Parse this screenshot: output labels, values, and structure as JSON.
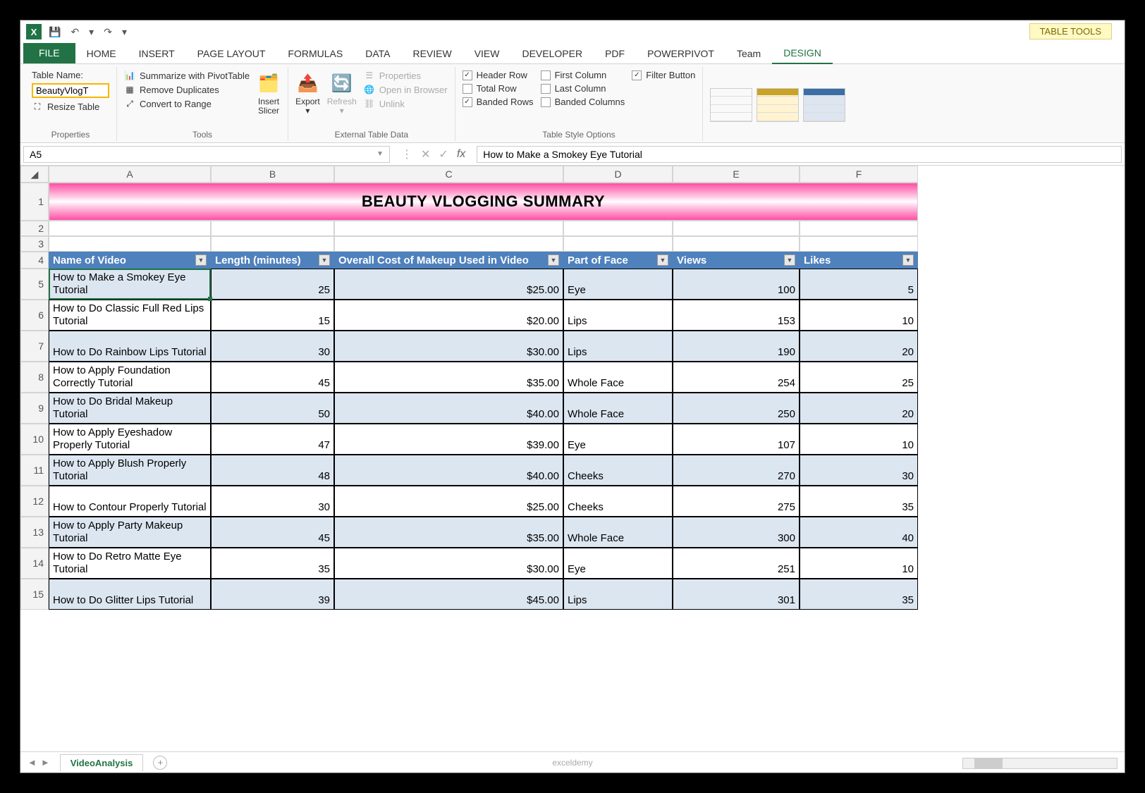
{
  "qat": {
    "save": "💾",
    "undo": "↶",
    "redo": "↷",
    "dd": "▾"
  },
  "table_tools_label": "TABLE TOOLS",
  "tabs": {
    "file": "FILE",
    "home": "HOME",
    "insert": "INSERT",
    "page_layout": "PAGE LAYOUT",
    "formulas": "FORMULAS",
    "data": "DATA",
    "review": "REVIEW",
    "view": "VIEW",
    "developer": "DEVELOPER",
    "pdf": "PDF",
    "powerpivot": "POWERPIVOT",
    "team": "Team",
    "design": "DESIGN"
  },
  "ribbon": {
    "properties": {
      "label": "Properties",
      "table_name_label": "Table Name:",
      "table_name_value": "BeautyVlogT",
      "resize": "Resize Table"
    },
    "tools": {
      "label": "Tools",
      "summarize": "Summarize with PivotTable",
      "remove_dup": "Remove Duplicates",
      "convert": "Convert to Range",
      "slicer": "Insert\nSlicer"
    },
    "external": {
      "label": "External Table Data",
      "export": "Export",
      "refresh": "Refresh",
      "props": "Properties",
      "open_browser": "Open in Browser",
      "unlink": "Unlink"
    },
    "style_opts": {
      "label": "Table Style Options",
      "header_row": "Header Row",
      "total_row": "Total Row",
      "banded_rows": "Banded Rows",
      "first_col": "First Column",
      "last_col": "Last Column",
      "banded_cols": "Banded Columns",
      "filter_btn": "Filter Button"
    }
  },
  "formula_bar": {
    "name_box": "A5",
    "value": "How to Make a Smokey Eye Tutorial"
  },
  "sheet": {
    "columns": [
      "A",
      "B",
      "C",
      "D",
      "E",
      "F"
    ],
    "title": "BEAUTY VLOGGING SUMMARY",
    "headers": [
      "Name of Video",
      "Length (minutes)",
      "Overall Cost of Makeup Used in Video",
      "Part of Face",
      "Views",
      "Likes"
    ],
    "rows": [
      {
        "n": 5,
        "a": "How to Make a Smokey Eye Tutorial",
        "b": "25",
        "c": "$25.00",
        "d": "Eye",
        "e": "100",
        "f": "5"
      },
      {
        "n": 6,
        "a": "How to Do Classic Full Red Lips Tutorial",
        "b": "15",
        "c": "$20.00",
        "d": "Lips",
        "e": "153",
        "f": "10"
      },
      {
        "n": 7,
        "a": "How to Do Rainbow Lips Tutorial",
        "b": "30",
        "c": "$30.00",
        "d": "Lips",
        "e": "190",
        "f": "20"
      },
      {
        "n": 8,
        "a": "How to Apply Foundation Correctly Tutorial",
        "b": "45",
        "c": "$35.00",
        "d": "Whole Face",
        "e": "254",
        "f": "25"
      },
      {
        "n": 9,
        "a": "How to Do Bridal Makeup Tutorial",
        "b": "50",
        "c": "$40.00",
        "d": "Whole Face",
        "e": "250",
        "f": "20"
      },
      {
        "n": 10,
        "a": "How to Apply Eyeshadow Properly Tutorial",
        "b": "47",
        "c": "$39.00",
        "d": "Eye",
        "e": "107",
        "f": "10"
      },
      {
        "n": 11,
        "a": "How to Apply Blush Properly Tutorial",
        "b": "48",
        "c": "$40.00",
        "d": "Cheeks",
        "e": "270",
        "f": "30"
      },
      {
        "n": 12,
        "a": "How to Contour Properly Tutorial",
        "b": "30",
        "c": "$25.00",
        "d": "Cheeks",
        "e": "275",
        "f": "35"
      },
      {
        "n": 13,
        "a": "How to Apply Party Makeup Tutorial",
        "b": "45",
        "c": "$35.00",
        "d": "Whole Face",
        "e": "300",
        "f": "40"
      },
      {
        "n": 14,
        "a": "How to Do Retro Matte Eye Tutorial",
        "b": "35",
        "c": "$30.00",
        "d": "Eye",
        "e": "251",
        "f": "10"
      },
      {
        "n": 15,
        "a": "How to Do Glitter Lips Tutorial",
        "b": "39",
        "c": "$45.00",
        "d": "Lips",
        "e": "301",
        "f": "35"
      }
    ]
  },
  "sheet_tab": "VideoAnalysis",
  "watermark": "exceldemy"
}
